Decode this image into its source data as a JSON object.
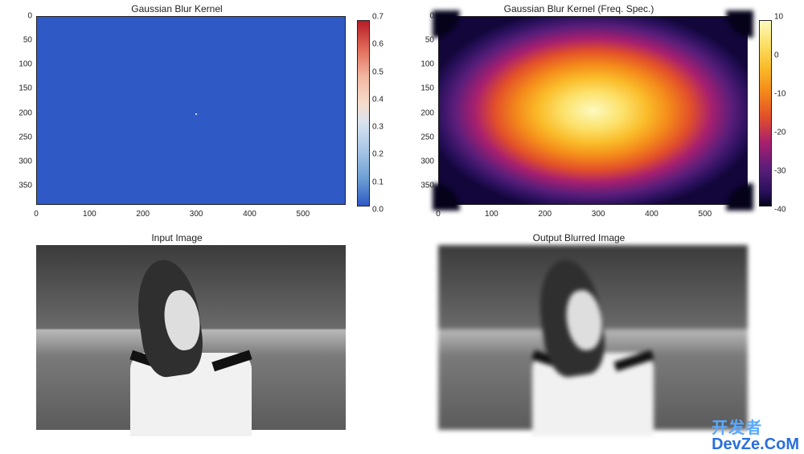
{
  "plots": {
    "kernel": {
      "title": "Gaussian Blur Kernel",
      "x_ticks": [
        "0",
        "100",
        "200",
        "300",
        "400",
        "500"
      ],
      "y_ticks": [
        "0",
        "50",
        "100",
        "150",
        "200",
        "250",
        "300",
        "350"
      ],
      "colorbar_ticks": [
        "0.7",
        "0.6",
        "0.5",
        "0.4",
        "0.3",
        "0.2",
        "0.1",
        "0.0"
      ],
      "background_color": "#2f59c4",
      "dot": {
        "x_frac": 0.515,
        "y_frac": 0.515
      }
    },
    "freq": {
      "title": "Gaussian Blur Kernel (Freq. Spec.)",
      "x_ticks": [
        "0",
        "100",
        "200",
        "300",
        "400",
        "500"
      ],
      "y_ticks": [
        "0",
        "50",
        "100",
        "150",
        "200",
        "250",
        "300",
        "350"
      ],
      "colorbar_ticks": [
        "10",
        "0",
        "-10",
        "-20",
        "-30",
        "-40"
      ]
    },
    "input": {
      "title": "Input Image"
    },
    "output": {
      "title": "Output Blurred Image"
    }
  },
  "watermark": {
    "cn": "开发者",
    "en": "DevZe.CoM"
  },
  "chart_data": [
    {
      "type": "heatmap",
      "title": "Gaussian Blur Kernel",
      "xlabel": "",
      "ylabel": "",
      "xlim": [
        0,
        580
      ],
      "ylim": [
        390,
        0
      ],
      "description": "2D Gaussian kernel, single bright point near (300,200), zero elsewhere",
      "peak": {
        "x": 300,
        "y": 200,
        "value": 0.75
      },
      "value_range": [
        0.0,
        0.75
      ],
      "colormap": "coolwarm",
      "x_ticks": [
        0,
        100,
        200,
        300,
        400,
        500
      ],
      "y_ticks": [
        0,
        50,
        100,
        150,
        200,
        250,
        300,
        350
      ]
    },
    {
      "type": "heatmap",
      "title": "Gaussian Blur Kernel (Freq. Spec.)",
      "xlabel": "",
      "ylabel": "",
      "xlim": [
        0,
        580
      ],
      "ylim": [
        390,
        0
      ],
      "description": "Log-magnitude frequency spectrum of shifted Gaussian kernel; bright center, dark corners",
      "center_value": 14,
      "corner_value": -46,
      "value_range": [
        -46,
        14
      ],
      "colormap": "inferno",
      "x_ticks": [
        0,
        100,
        200,
        300,
        400,
        500
      ],
      "y_ticks": [
        0,
        50,
        100,
        150,
        200,
        250,
        300,
        350
      ]
    },
    {
      "type": "image",
      "title": "Input Image",
      "description": "Grayscale photograph of a woman with long hair, head tilted, off-shoulder top, foliage background"
    },
    {
      "type": "image",
      "title": "Output Blurred Image",
      "description": "Same photograph after applying Gaussian blur via frequency-domain multiplication"
    }
  ]
}
